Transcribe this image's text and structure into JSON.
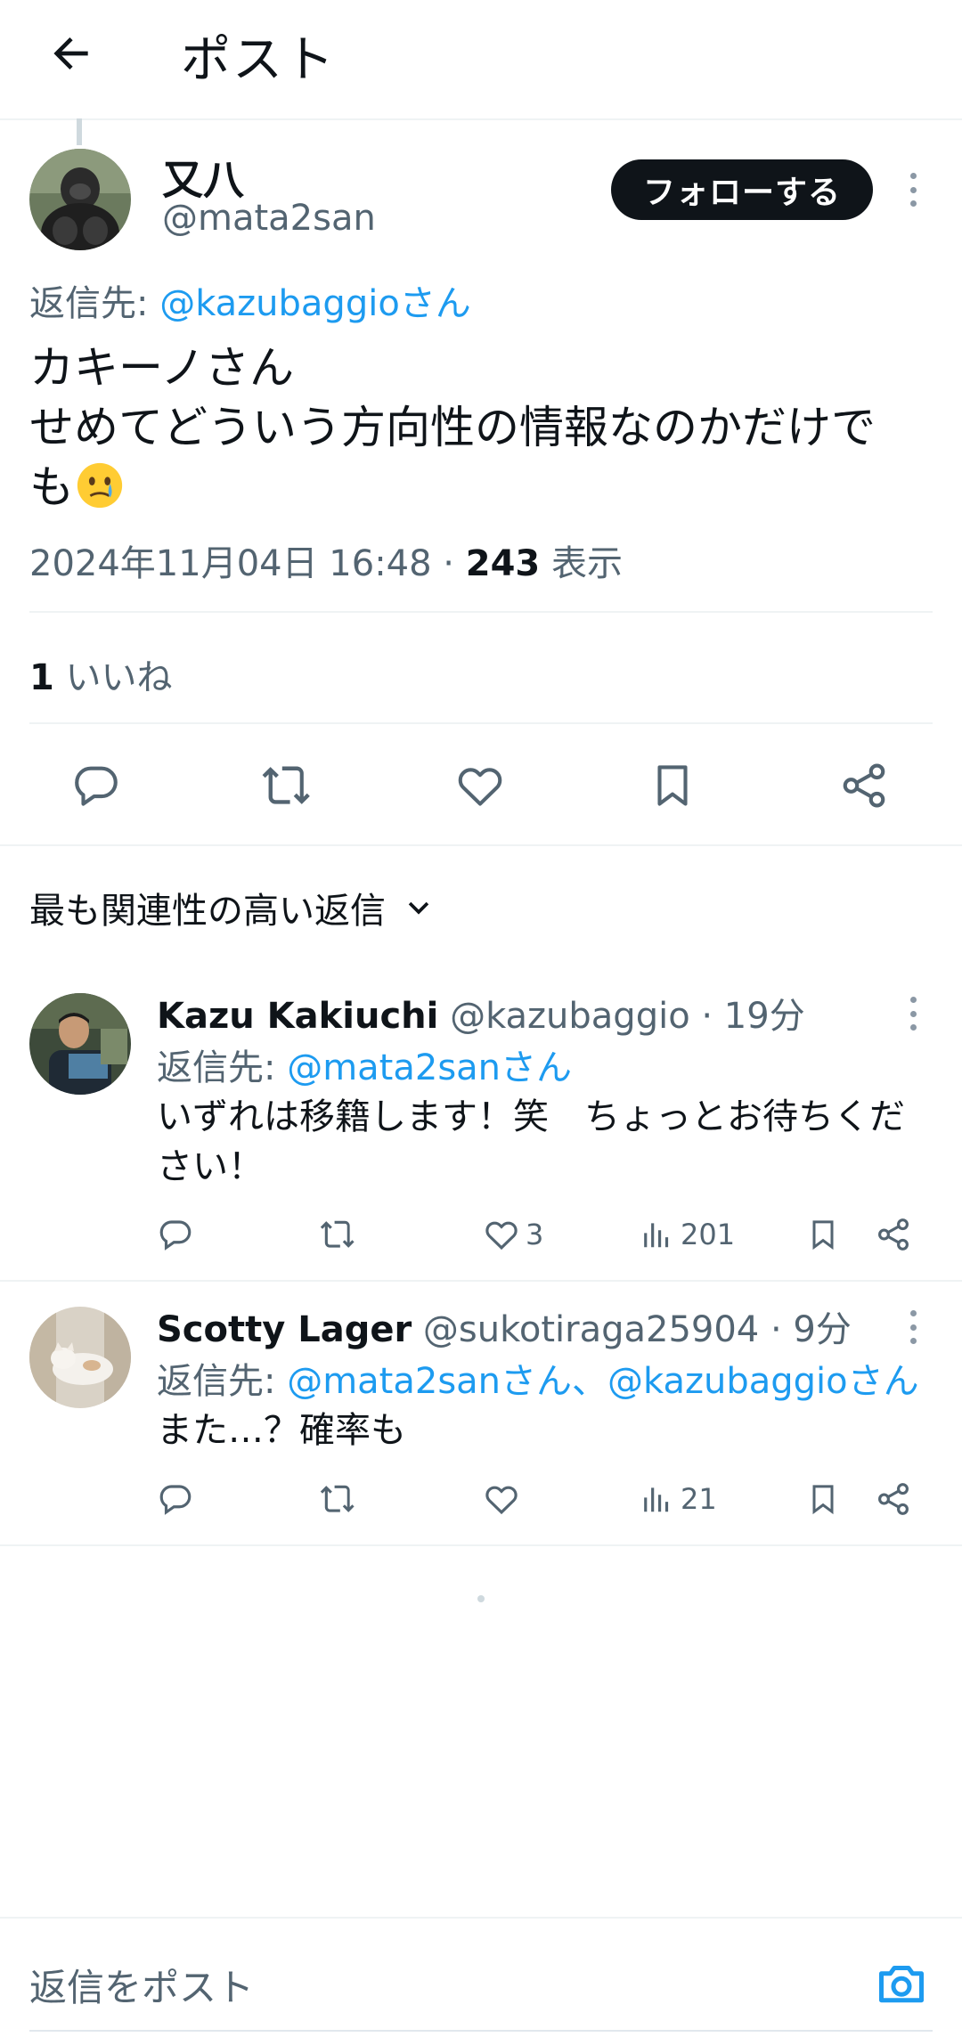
{
  "header": {
    "title": "ポスト"
  },
  "post": {
    "display_name": "又八",
    "handle": "@mata2san",
    "follow_label": "フォローする",
    "reply_prefix": "返信先: ",
    "reply_to": "@kazubaggioさん",
    "text_line1": "カキーノさん",
    "text_line2": "せめてどういう方向性の情報なのかだけで",
    "text_line3": "も",
    "emoji": "🥲",
    "datetime": "2024年11月04日 16:48 · ",
    "views_count": "243",
    "views_label": " 表示",
    "likes_count": "1",
    "likes_label": " いいね"
  },
  "sort": {
    "label": "最も関連性の高い返信"
  },
  "replies": [
    {
      "name": "Kazu Kakiuchi",
      "handle": " @kazubaggio · 19分",
      "reply_prefix": "返信先: ",
      "reply_to": "@mata2sanさん",
      "text": "いずれは移籍します！笑　ちょっとお待ちください！",
      "likes": "3",
      "views": "201"
    },
    {
      "name": "Scotty Lager",
      "handle": " @sukotiraga25904 · 9分",
      "reply_prefix": "返信先: ",
      "reply_to": "@mata2sanさん、@kazubaggioさん",
      "text": "また…？確率も",
      "likes": "",
      "views": "21"
    }
  ],
  "compose": {
    "placeholder": "返信をポスト"
  },
  "colors": {
    "accent": "#1d9bf0",
    "text": "#0f1419",
    "secondary": "#536471"
  }
}
